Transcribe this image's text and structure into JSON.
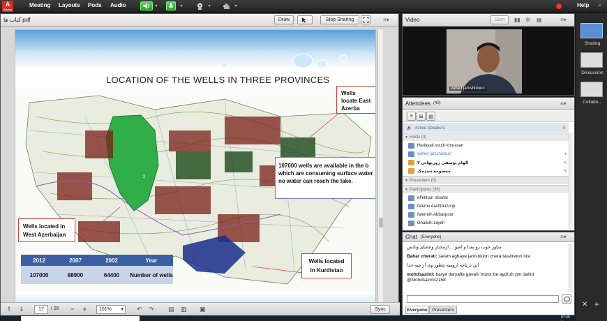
{
  "menubar": {
    "logo_text": "Adobe",
    "items": [
      "Meeting",
      "Layouts",
      "Pods",
      "Audio"
    ],
    "help": "Help"
  },
  "share": {
    "filename": "کتاب ها.pdf",
    "draw_label": "Draw",
    "stop_label": "Stop Sharing",
    "page_current": "17",
    "page_total": "/ 26",
    "zoom": "101%",
    "sync_label": "Sync"
  },
  "slide": {
    "title": "LOCATION OF THE WELLS IN THREE PROVINCES",
    "callout_east": "Wells locate East Azerba",
    "callout_west_l1": "Wells located in",
    "callout_west_l2": "West Azerbaijan",
    "callout_kurd_l1": "Wells located",
    "callout_kurd_l2": "in Kurdistan",
    "info_l1": "107000 wells are available in the b",
    "info_l2": "which are consuming surface water",
    "info_l3": "no water can reach the lake.",
    "map_label": "2",
    "table_headers": [
      "2012",
      "2007",
      "2002",
      "Year"
    ],
    "table_values": [
      "107000",
      "88900",
      "64400",
      "Number of wells"
    ]
  },
  "video": {
    "title": "Video",
    "start_label": "Start",
    "name": "vahed jamshidoun"
  },
  "attendees": {
    "title": "Attendees",
    "count": "(40)",
    "active_speakers": "Active Speakers",
    "hosts_header": "Hosts (4)",
    "hosts": [
      "Hedayati south khorasan",
      "vahed jamshidoun",
      "الهام یوسفی روزبهانی ۳",
      "معصومه سیدمک"
    ],
    "presenters_header": "Presenters (0)",
    "participants_header": "Participants (36)",
    "participants": [
      "effekhari niloofar",
      "fateme dashtbozorgi",
      "fatemeh Abbaspour",
      "Ghalichi zayeh"
    ]
  },
  "chat": {
    "title": "Chat",
    "scope": "(Everyone)",
    "messages": [
      {
        "sender": "",
        "text": "متاور خوب زو بعدا و اصو ... ازمختار وعضای وثانس"
      },
      {
        "sender": "Bahar cherati:",
        "text": "salam aghaye jamshidon chera tasvireton nist"
      },
      {
        "sender": "",
        "text": "این دریاچه ارومیه چطور وی از چیه خدا"
      },
      {
        "sender": "mohdsazimi:",
        "text": "barye daryafte gavahi hozor be aydi zir pm dahid @Mohdsazimi2168"
      }
    ],
    "tab_everyone": "Everyone",
    "tab_presenters": "Presenters"
  },
  "layouts": {
    "items": [
      "Sharing",
      "Discussion",
      "Collabo..."
    ]
  },
  "taskbar": {
    "clock": "07:30 ب.ظ"
  }
}
